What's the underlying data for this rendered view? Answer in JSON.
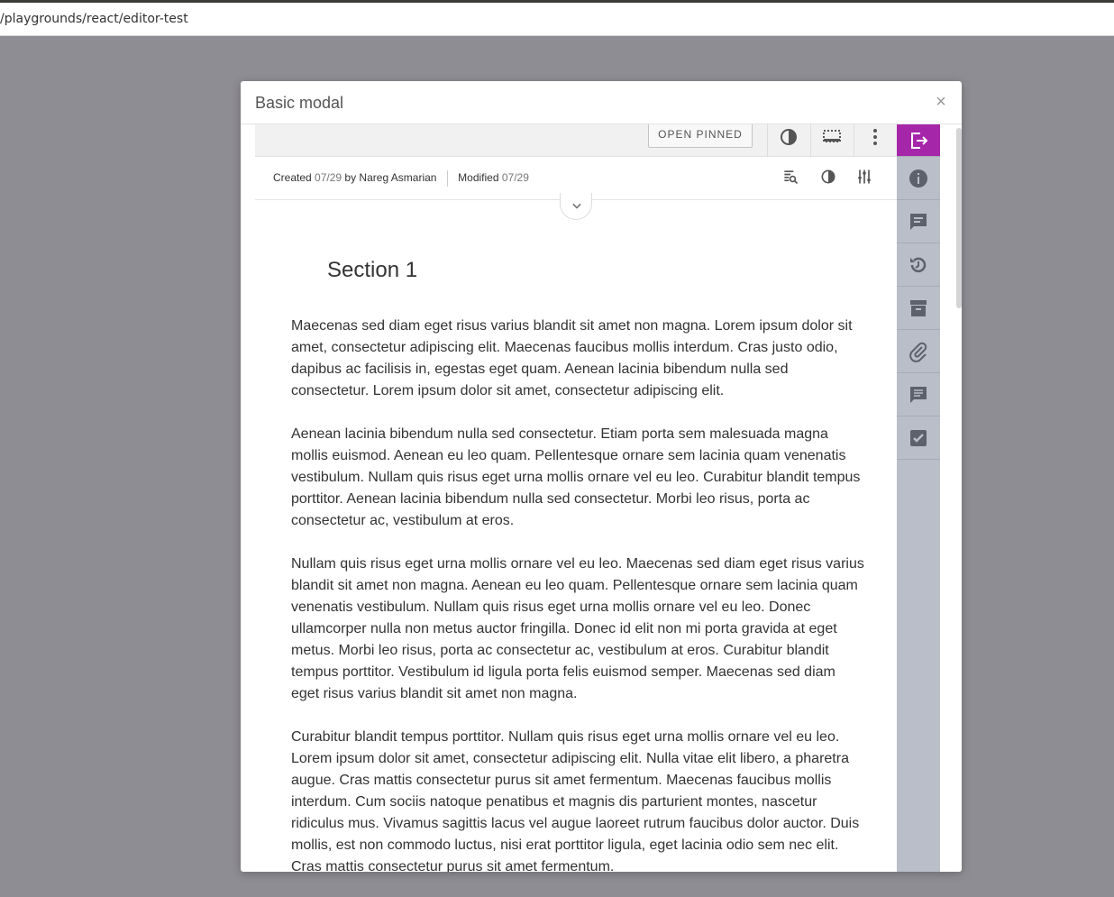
{
  "browser": {
    "url": "/playgrounds/react/editor-test"
  },
  "modal": {
    "title": "Basic modal",
    "close_label": "×"
  },
  "toolbar": {
    "open_pinned_label": "OPEN PINNED"
  },
  "meta": {
    "created_label": "Created",
    "created_date": "07/29",
    "by_label": "by Nareg Asmarian",
    "modified_label": "Modified",
    "modified_date": "07/29"
  },
  "document": {
    "section_title": "Section 1",
    "paragraphs": [
      "Maecenas sed diam eget risus varius blandit sit amet non magna. Lorem ipsum dolor sit amet, consectetur adipiscing elit. Maecenas faucibus mollis interdum. Cras justo odio, dapibus ac facilisis in, egestas eget quam. Aenean lacinia bibendum nulla sed consectetur. Lorem ipsum dolor sit amet, consectetur adipiscing elit.",
      "Aenean lacinia bibendum nulla sed consectetur. Etiam porta sem malesuada magna mollis euismod. Aenean eu leo quam. Pellentesque ornare sem lacinia quam venenatis vestibulum. Nullam quis risus eget urna mollis ornare vel eu leo. Curabitur blandit tempus porttitor. Aenean lacinia bibendum nulla sed consectetur. Morbi leo risus, porta ac consectetur ac, vestibulum at eros.",
      "Nullam quis risus eget urna mollis ornare vel eu leo. Maecenas sed diam eget risus varius blandit sit amet non magna. Aenean eu leo quam. Pellentesque ornare sem lacinia quam venenatis vestibulum. Nullam quis risus eget urna mollis ornare vel eu leo. Donec ullamcorper nulla non metus auctor fringilla. Donec id elit non mi porta gravida at eget metus. Morbi leo risus, porta ac consectetur ac, vestibulum at eros. Curabitur blandit tempus porttitor. Vestibulum id ligula porta felis euismod semper. Maecenas sed diam eget risus varius blandit sit amet non magna.",
      "Curabitur blandit tempus porttitor. Nullam quis risus eget urna mollis ornare vel eu leo. Lorem ipsum dolor sit amet, consectetur adipiscing elit. Nulla vitae elit libero, a pharetra augue. Cras mattis consectetur purus sit amet fermentum. Maecenas faucibus mollis interdum. Cum sociis natoque penatibus et magnis dis parturient montes, nascetur ridiculus mus. Vivamus sagittis lacus vel augue laoreet rutrum faucibus dolor auctor. Duis mollis, est non commodo luctus, nisi erat porttitor ligula, eget lacinia odio sem nec elit. Cras mattis consectetur purus sit amet fermentum."
    ]
  },
  "rail": {
    "items": [
      "exit-panel-icon",
      "info-icon",
      "comments-icon",
      "history-icon",
      "archive-icon",
      "attachment-icon",
      "notes-icon",
      "tasks-icon"
    ]
  },
  "colors": {
    "accent": "#a626a9",
    "rail_bg": "#b9bec8",
    "backdrop": "#8e8d93"
  }
}
